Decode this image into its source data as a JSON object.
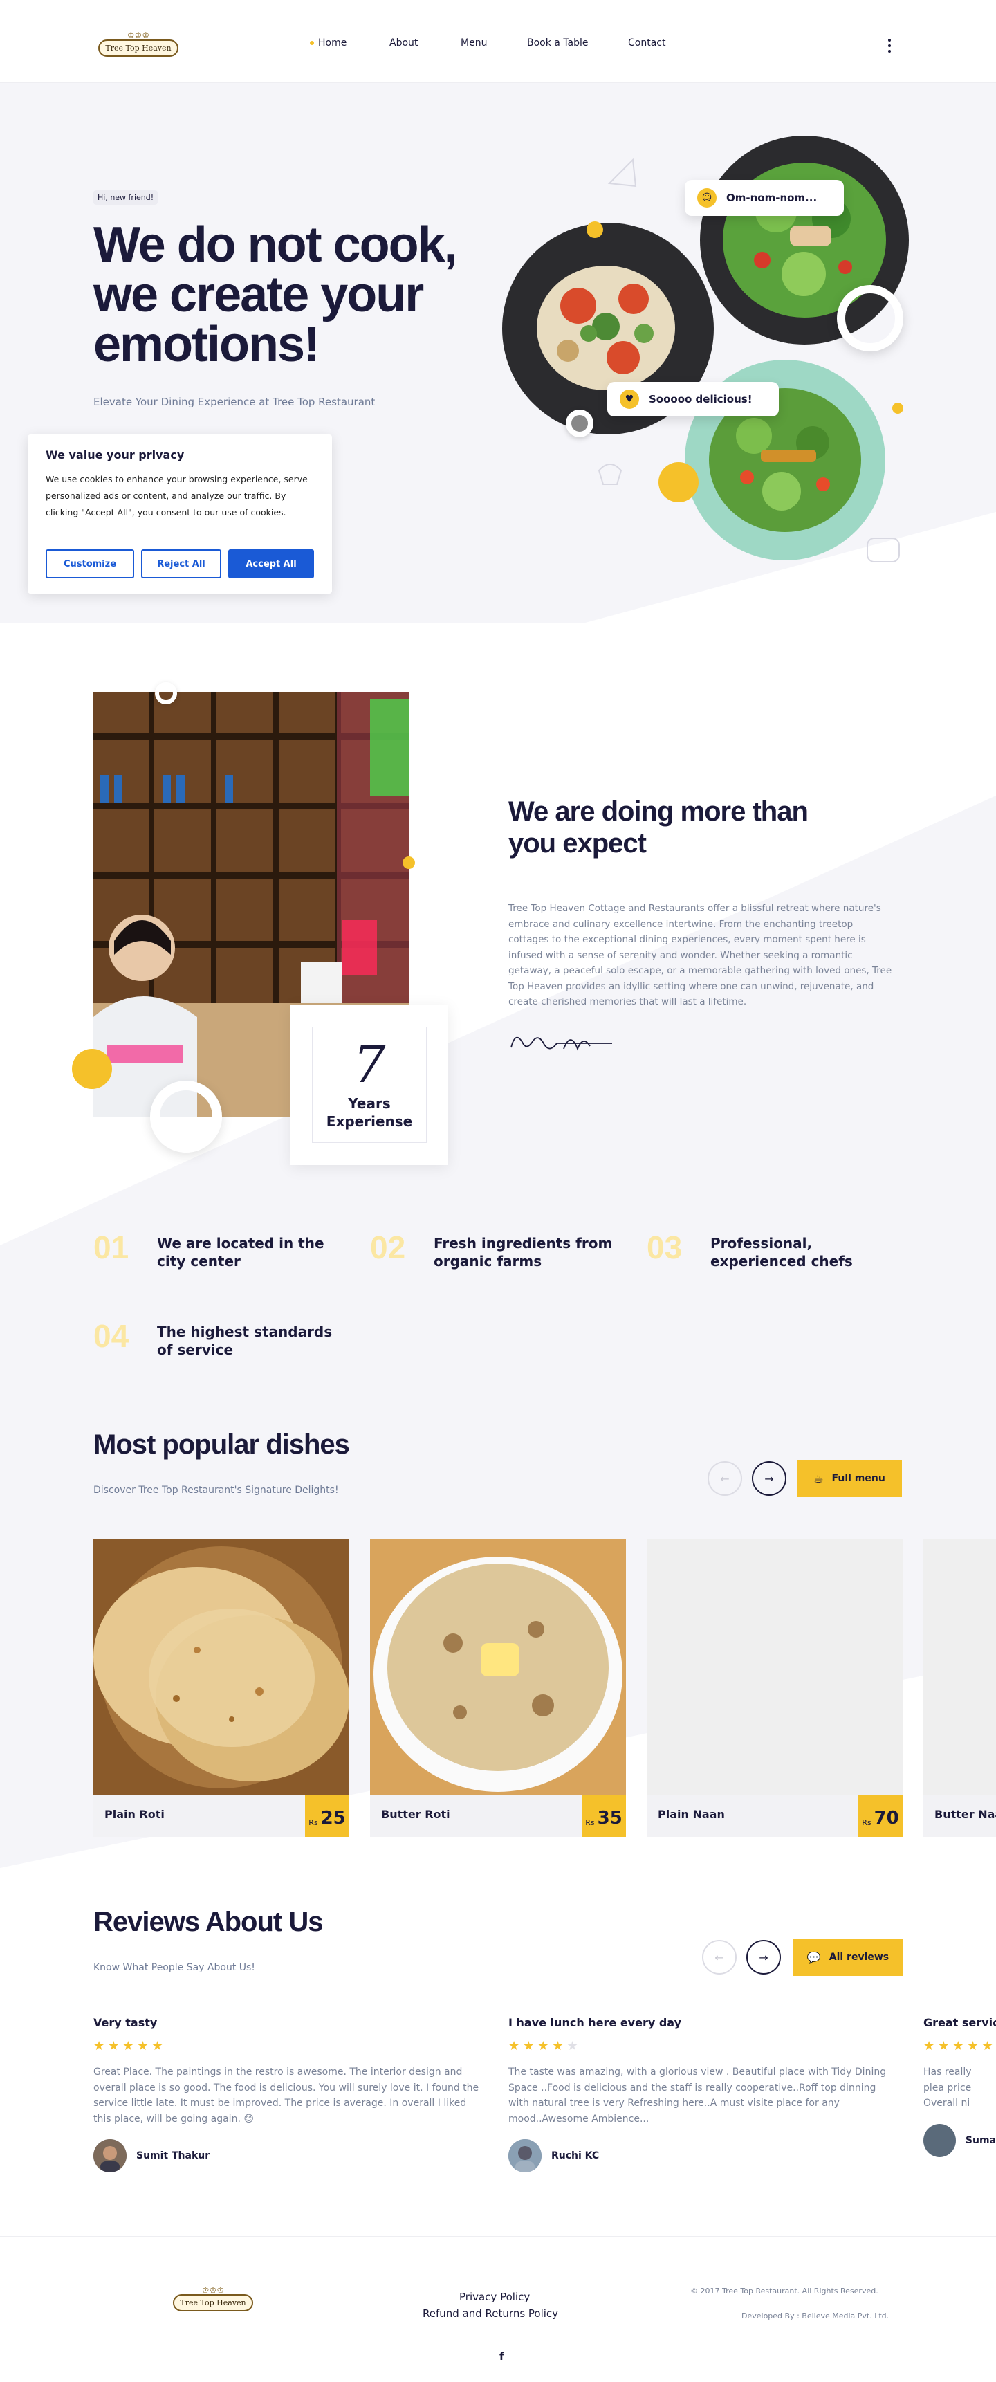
{
  "brand": {
    "name": "Tree Top Heaven"
  },
  "nav": {
    "items": [
      {
        "label": "Home",
        "active": true
      },
      {
        "label": "About"
      },
      {
        "label": "Menu"
      },
      {
        "label": "Book a Table"
      },
      {
        "label": "Contact"
      }
    ],
    "more_icon": "kebab-menu-icon"
  },
  "hero": {
    "badge": "Hi, new friend!",
    "title": "We do not cook, we create your emotions!",
    "subtitle": "Elevate Your Dining Experience at Tree Top Restaurant",
    "bubble1": "Om-nom-nom...",
    "bubble2": "Sooooo delicious!"
  },
  "cookie": {
    "title": "We value your privacy",
    "text": "We use cookies to enhance your browsing experience, serve personalized ads or content, and analyze our traffic. By clicking \"Accept All\", you consent to our use of cookies.",
    "customize": "Customize",
    "reject": "Reject All",
    "accept": "Accept All"
  },
  "about": {
    "years_number": "7",
    "years_label": "Years Experiense",
    "title": "We are doing more than you expect",
    "text": "Tree Top Heaven Cottage and Restaurants offer a blissful retreat where nature's embrace and culinary excellence intertwine. From the enchanting treetop cottages to the exceptional dining experiences, every moment spent here is infused with a sense of serenity and wonder. Whether seeking a romantic getaway, a peaceful solo escape, or a memorable gathering with loved ones, Tree Top Heaven provides an idyllic setting where one can unwind, rejuvenate, and create cherished memories that will last a lifetime."
  },
  "features": [
    {
      "num": "01",
      "text": "We are located in the city center"
    },
    {
      "num": "02",
      "text": "Fresh ingredients from organic farms"
    },
    {
      "num": "03",
      "text": "Professional, experienced chefs"
    },
    {
      "num": "04",
      "text": "The highest standards of service"
    }
  ],
  "dishes": {
    "title": "Most popular dishes",
    "subtitle": "Discover Tree Top Restaurant's Signature Delights!",
    "full_menu": "Full menu",
    "items": [
      {
        "name": "Plain Roti",
        "currency": "Rs",
        "price": "25"
      },
      {
        "name": "Butter Roti",
        "currency": "Rs",
        "price": "35"
      },
      {
        "name": "Plain Naan",
        "currency": "Rs",
        "price": "70"
      },
      {
        "name": "Butter Naa"
      }
    ]
  },
  "reviews": {
    "title": "Reviews About Us",
    "subtitle": "Know What People Say About Us!",
    "all_reviews": "All reviews",
    "items": [
      {
        "title": "Very tasty",
        "rating": 5,
        "text": "Great Place. The paintings in the restro is awesome. The interior design and overall place is so good. The food is delicious. You will surely love it. I found the service little late. It must be improved. The price is average. In overall I liked this place, will be going again. 😊",
        "author": "Sumit Thakur"
      },
      {
        "title": "I have lunch here every day",
        "rating": 4,
        "text": "The taste was amazing, with a glorious view . Beautiful place with Tidy Dining Space ..Food is delicious and the staff is really cooperative..Roff top dinning with natural tree is very Refreshing here..A must visite place for any mood..Awesome Ambience...",
        "author": "Ruchi KC"
      },
      {
        "title": "Great service",
        "text": "Has really plea price Overall ni",
        "author": "Suma"
      }
    ]
  },
  "footer": {
    "privacy": "Privacy Policy",
    "refund": "Refund and Returns Policy",
    "copyright": "© 2017 Tree Top Restaurant. All Rights Reserved.",
    "developer": "Developed By : Believe Media Pvt. Ltd.",
    "social_icon": "facebook-icon"
  },
  "colors": {
    "accent": "#f5c12a",
    "dark": "#1b1a3a",
    "button_blue": "#1a5ad6"
  }
}
